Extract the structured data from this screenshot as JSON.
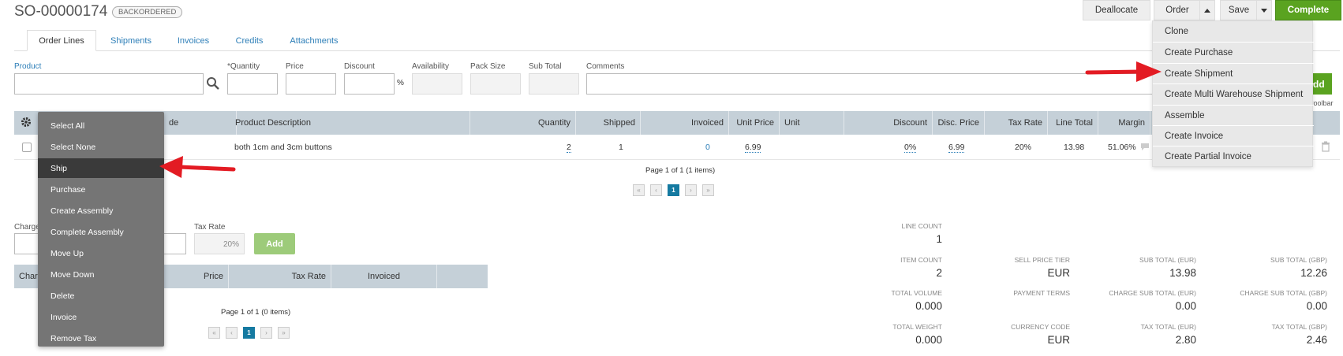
{
  "header": {
    "order_number": "SO-00000174",
    "status": "BACKORDERED",
    "buttons": {
      "deallocate": "Deallocate",
      "order": "Order",
      "save": "Save",
      "complete": "Complete"
    }
  },
  "tabs": [
    "Order Lines",
    "Shipments",
    "Invoices",
    "Credits",
    "Attachments"
  ],
  "form": {
    "labels": {
      "product": "Product",
      "quantity": "*Quantity",
      "price": "Price",
      "discount": "Discount",
      "availability": "Availability",
      "pack_size": "Pack Size",
      "sub_total": "Sub Total",
      "comments": "Comments"
    },
    "percent": "%",
    "add_partial": "dd",
    "toolbar_hint": "toolbar"
  },
  "lines_table": {
    "headers": [
      "de",
      "Product Description",
      "Quantity",
      "Shipped",
      "Invoiced",
      "Unit Price",
      "Unit",
      "Discount",
      "Disc. Price",
      "Tax Rate",
      "Line Total",
      "Margin"
    ],
    "row": {
      "description": "both 1cm and 3cm buttons",
      "quantity": "2",
      "shipped": "1",
      "invoiced": "0",
      "unit_price": "6.99",
      "unit": "",
      "discount": "0%",
      "disc_price": "6.99",
      "tax_rate": "20%",
      "line_total": "13.98",
      "margin": "51.06%"
    },
    "pager_text": "Page 1 of 1 (1 items)",
    "current_page": "1"
  },
  "charges": {
    "charge_label": "Charge",
    "tax_rate_label": "Tax Rate",
    "tax_rate_value": "20%",
    "add": "Add",
    "headers": [
      "Char",
      "Price",
      "Tax Rate",
      "Invoiced"
    ],
    "pager_text": "Page 1 of 1 (0 items)",
    "current_page": "1"
  },
  "summary": {
    "line_count_label": "LINE COUNT",
    "line_count": "1",
    "item_count_label": "ITEM COUNT",
    "item_count": "2",
    "sell_price_tier_label": "SELL PRICE TIER",
    "sell_price_tier": "EUR",
    "sub_total_eur_label": "SUB TOTAL (EUR)",
    "sub_total_eur": "13.98",
    "sub_total_gbp_label": "SUB TOTAL (GBP)",
    "sub_total_gbp": "12.26",
    "total_volume_label": "TOTAL VOLUME",
    "total_volume": "0.000",
    "payment_terms_label": "PAYMENT TERMS",
    "payment_terms": "",
    "charge_sub_eur_label": "CHARGE SUB TOTAL (EUR)",
    "charge_sub_eur": "0.00",
    "charge_sub_gbp_label": "CHARGE SUB TOTAL (GBP)",
    "charge_sub_gbp": "0.00",
    "total_weight_label": "TOTAL WEIGHT",
    "total_weight": "0.000",
    "currency_code_label": "CURRENCY CODE",
    "currency_code": "EUR",
    "tax_total_eur_label": "TAX TOTAL (EUR)",
    "tax_total_eur": "2.80",
    "tax_total_gbp_label": "TAX TOTAL (GBP)",
    "tax_total_gbp": "2.46"
  },
  "context_menu": [
    "Select All",
    "Select None",
    "Ship",
    "Purchase",
    "Create Assembly",
    "Complete Assembly",
    "Move Up",
    "Move Down",
    "Delete",
    "Invoice",
    "Remove Tax"
  ],
  "order_menu": [
    "Clone",
    "Create Purchase",
    "Create Shipment",
    "Create Multi Warehouse Shipment",
    "Assemble",
    "Create Invoice",
    "Create Partial Invoice"
  ],
  "colors": {
    "accent_blue": "#2e7fb8",
    "complete_green": "#5aa320",
    "add_green": "#9dcb7a",
    "header_gray": "#c5d0d8",
    "menu_dark": "#757575",
    "arrow_red": "#e31b23"
  },
  "icons": [
    "search-icon",
    "gear-icon",
    "caret-up-icon",
    "caret-down-icon",
    "comment-icon",
    "trash-icon"
  ]
}
